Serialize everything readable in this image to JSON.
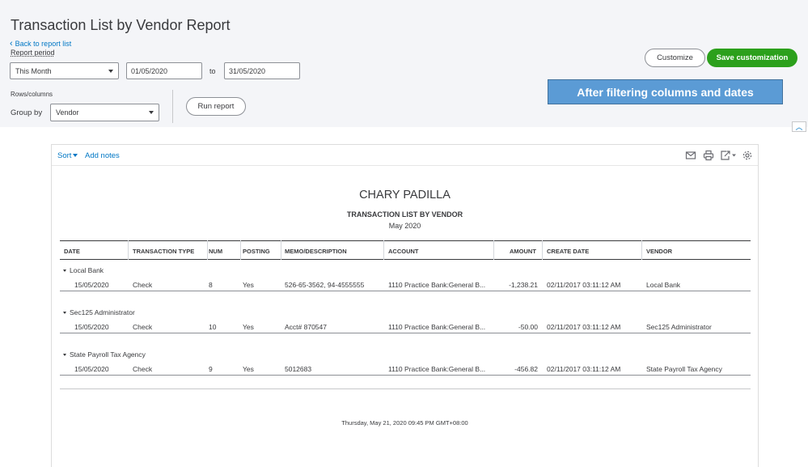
{
  "header": {
    "title": "Transaction List by Vendor Report",
    "back_link": "Back to report list",
    "report_period_label": "Report period",
    "period_select": "This Month",
    "date_from": "01/05/2020",
    "to_label": "to",
    "date_to": "31/05/2020",
    "rows_columns_label": "Rows/columns",
    "group_by_label": "Group by",
    "group_by_value": "Vendor",
    "run_report": "Run report",
    "customize": "Customize",
    "save_customization": "Save customization"
  },
  "annotation": "After filtering columns and dates",
  "toolbar": {
    "sort": "Sort",
    "add_notes": "Add notes"
  },
  "report": {
    "company": "CHARY PADILLA",
    "title": "TRANSACTION LIST BY VENDOR",
    "period": "May 2020",
    "columns": [
      "DATE",
      "TRANSACTION TYPE",
      "NUM",
      "POSTING",
      "MEMO/DESCRIPTION",
      "ACCOUNT",
      "AMOUNT",
      "CREATE DATE",
      "VENDOR"
    ],
    "groups": [
      {
        "name": "Local Bank",
        "row": {
          "date": "15/05/2020",
          "type": "Check",
          "num": "8",
          "posting": "Yes",
          "memo": "526-65-3562, 94-4555555",
          "account": "1110 Practice Bank:General B...",
          "amount": "-1,238.21",
          "create_date": "02/11/2017 03:11:12 AM",
          "vendor": "Local Bank"
        }
      },
      {
        "name": "Sec125 Administrator",
        "row": {
          "date": "15/05/2020",
          "type": "Check",
          "num": "10",
          "posting": "Yes",
          "memo": "Acct# 870547",
          "account": "1110 Practice Bank:General B...",
          "amount": "-50.00",
          "create_date": "02/11/2017 03:11:12 AM",
          "vendor": "Sec125 Administrator"
        }
      },
      {
        "name": "State Payroll Tax Agency",
        "row": {
          "date": "15/05/2020",
          "type": "Check",
          "num": "9",
          "posting": "Yes",
          "memo": "5012683",
          "account": "1110 Practice Bank:General B...",
          "amount": "-456.82",
          "create_date": "02/11/2017 03:11:12 AM",
          "vendor": "State Payroll Tax Agency"
        }
      }
    ],
    "footer": "Thursday, May 21, 2020   09:45 PM GMT+08:00"
  },
  "colors": {
    "green": "#2ca01c",
    "link": "#0077c5",
    "banner": "#5b9bd5"
  },
  "icons": [
    "email-icon",
    "print-icon",
    "export-icon",
    "settings-icon"
  ]
}
